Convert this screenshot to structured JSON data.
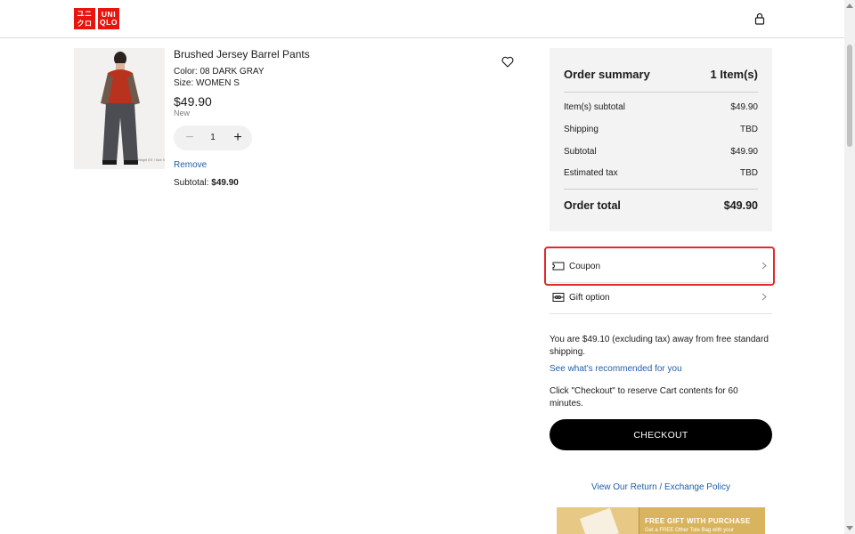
{
  "header": {
    "logo_top": "ユニクロ",
    "logo_bottom_left": "UNI",
    "logo_bottom_right": "QLO",
    "account_icon": "user-icon"
  },
  "product": {
    "name": "Brushed Jersey Barrel Pants",
    "color": "Color: 08 DARK GRAY",
    "size": "Size: WOMEN S",
    "price": "$49.90",
    "badge": "New",
    "quantity": "1",
    "remove_label": "Remove",
    "subtotal_label": "Subtotal: ",
    "subtotal_value": "$49.90",
    "image_caption": "Height 5'6\" / Size S"
  },
  "summary": {
    "title": "Order summary",
    "item_count": "1 Item(s)",
    "rows": [
      {
        "label": "Item(s) subtotal",
        "value": "$49.90"
      },
      {
        "label": "Shipping",
        "value": "TBD"
      },
      {
        "label": "Subtotal",
        "value": "$49.90"
      },
      {
        "label": "Estimated tax",
        "value": "TBD"
      }
    ],
    "total_label": "Order total",
    "total_value": "$49.90"
  },
  "options": {
    "coupon": "Coupon",
    "gift": "Gift option"
  },
  "shipping_message": "You are $49.10 (excluding tax) away from free standard shipping.",
  "recommended_link": "See what's recommended for you",
  "reserve_message": "Click \"Checkout\" to reserve Cart contents for 60 minutes.",
  "checkout_label": "CHECKOUT",
  "policy_link": "View Our Return / Exchange Policy",
  "banner": {
    "title": "FREE GIFT WITH PURCHASE",
    "subtitle": "Get a FREE Other Tote Bag with your"
  },
  "colors": {
    "brand_red": "#e8150f",
    "link_blue": "#1f5fa6",
    "highlight": "#e32a2a"
  }
}
